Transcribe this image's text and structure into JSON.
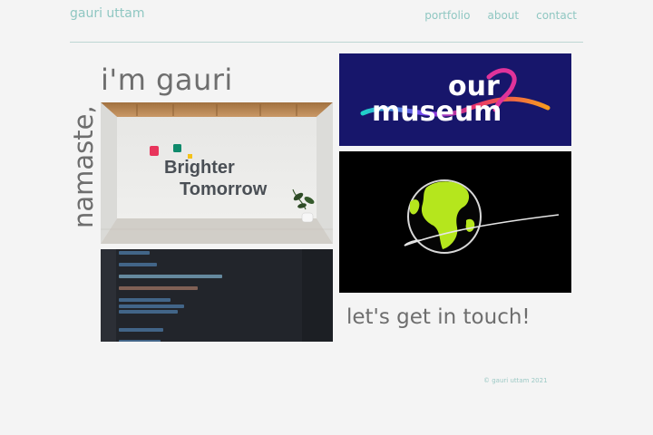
{
  "header": {
    "brand": "gauri uttam",
    "nav": [
      "portfolio",
      "about",
      "contact"
    ]
  },
  "hero": {
    "greeting": "i'm gauri",
    "side_text": "namaste,"
  },
  "projects": [
    {
      "title_line1": "Brighter",
      "title_line2": "Tomorrow"
    },
    {
      "title_line1": "our",
      "title_line2": "museum"
    }
  ],
  "cta": {
    "label": "let's get in touch!"
  },
  "footer": {
    "copyright": "© gauri uttam 2021"
  },
  "colors": {
    "accent": "#8fc7c2",
    "heading": "#6e6e6e",
    "museum_bg": "#17166b",
    "globe_land": "#b5e61d"
  }
}
